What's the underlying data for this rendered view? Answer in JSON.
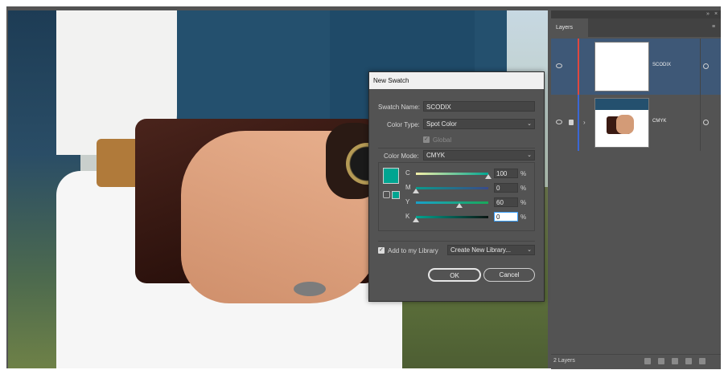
{
  "dialog": {
    "title": "New Swatch",
    "swatch_name_label": "Swatch Name:",
    "swatch_name_value": "SCODIX",
    "color_type_label": "Color Type:",
    "color_type_value": "Spot Color",
    "global_label": "Global",
    "color_mode_label": "Color Mode:",
    "color_mode_value": "CMYK",
    "swatch_color": "#00a591",
    "channels": [
      {
        "label": "C",
        "value": "100",
        "level": 1.0
      },
      {
        "label": "M",
        "value": "0",
        "level": 0.0
      },
      {
        "label": "Y",
        "value": "60",
        "level": 0.6
      },
      {
        "label": "K",
        "value": "0",
        "level": 0.0
      }
    ],
    "percent_sign": "%",
    "add_to_library_label": "Add to my Library",
    "library_value": "Create New Library...",
    "ok_label": "OK",
    "cancel_label": "Cancel"
  },
  "layers_panel": {
    "tab_label": "Layers",
    "layers": [
      {
        "name": "SCODIX",
        "color": "#e0483f"
      },
      {
        "name": "CMYK",
        "color": "#3a67d6"
      }
    ],
    "layer_count": "2 Layers"
  }
}
